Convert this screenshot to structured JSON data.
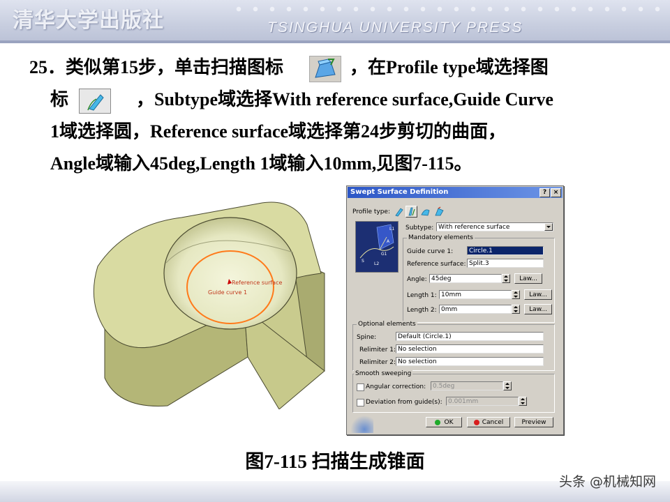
{
  "header": {
    "logo_text": "清华大学出版社",
    "press_text": "TSINGHUA UNIVERSITY PRESS"
  },
  "instruction": {
    "line1_a": "25．类似第15步，单击扫描图标",
    "line1_b": "，在Profile  type域选择图",
    "line2_a": "标",
    "line2_b": "，Subtype域选择With reference surface,Guide Curve",
    "line3": "1域选择圆，Reference  surface域选择第24步剪切的曲面，",
    "line4": "Angle域输入45deg,Length 1域输入10mm,见图7-115。"
  },
  "model": {
    "reference_label": "Reference surface",
    "guide_label": "Guide curve 1"
  },
  "dialog": {
    "title": "Swept Surface Definition",
    "help_btn": "?",
    "close_btn": "×",
    "profile_type_label": "Profile type:",
    "subtype_label": "Subtype:",
    "subtype_value": "With reference surface",
    "mandatory_group": "Mandatory elements",
    "guide_curve_label": "Guide curve 1:",
    "guide_curve_value": "Circle.1",
    "ref_surface_label": "Reference surface:",
    "ref_surface_value": "Split.3",
    "angle_label": "Angle:",
    "angle_value": "45deg",
    "length1_label": "Length 1:",
    "length1_value": "10mm",
    "length2_label": "Length 2:",
    "length2_value": "0mm",
    "law_btn": "Law...",
    "optional_group": "Optional elements",
    "spine_label": "Spine:",
    "spine_value": "Default (Circle.1)",
    "relimiter1_label": "Relimiter 1:",
    "relimiter1_value": "No selection",
    "relimiter2_label": "Relimiter 2:",
    "relimiter2_value": "No selection",
    "smooth_group": "Smooth sweeping",
    "angular_label": "Angular correction:",
    "angular_value": "0.5deg",
    "deviation_label": "Deviation from guide(s):",
    "deviation_value": "0.001mm",
    "ok_btn": "OK",
    "cancel_btn": "Cancel",
    "preview_btn": "Preview",
    "preview_labels": {
      "l1": "L1",
      "l2": "L2",
      "a": "A",
      "g1": "G1",
      "s": "S"
    }
  },
  "caption": "图7-115 扫描生成锥面",
  "watermark": "头条 @机械知网",
  "colors": {
    "title_bar": "#2c56c6",
    "selected_field": "#0a246a",
    "model_face": "#d9dba2",
    "guide_circle": "#ff7a1a"
  }
}
